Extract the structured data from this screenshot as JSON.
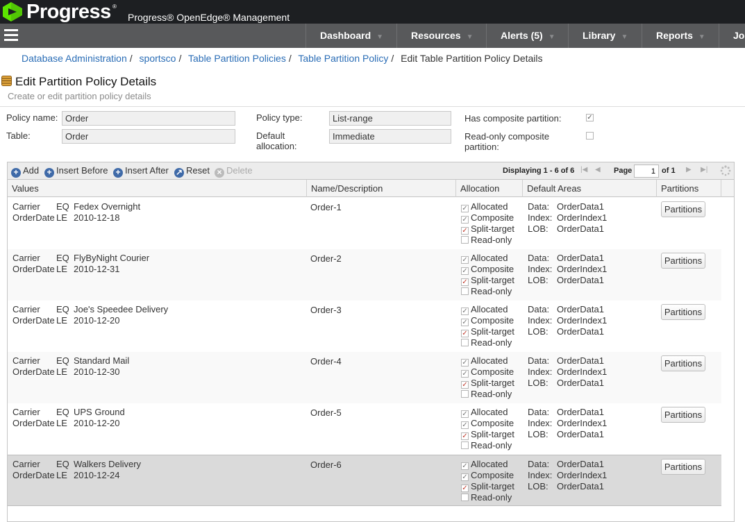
{
  "header": {
    "logo_text": "Progress",
    "logo_reg": "®",
    "product": "Progress® OpenEdge® Management"
  },
  "nav": {
    "items": [
      {
        "label": "Dashboard"
      },
      {
        "label": "Resources"
      },
      {
        "label": "Alerts (5)"
      },
      {
        "label": "Library"
      },
      {
        "label": "Reports"
      },
      {
        "label": "Jo"
      }
    ]
  },
  "breadcrumb": {
    "items": [
      "Database Administration",
      "sportsco",
      "Table Partition Policies",
      "Table Partition Policy"
    ],
    "current": "Edit Table Partition Policy Details",
    "sep": "/"
  },
  "page": {
    "title": "Edit Partition Policy Details",
    "subtitle": "Create or edit partition policy details"
  },
  "form": {
    "policy_name_label": "Policy name:",
    "policy_name_value": "Order",
    "table_label": "Table:",
    "table_value": "Order",
    "policy_type_label": "Policy type:",
    "policy_type_value": "List-range",
    "default_alloc_label_1": "Default",
    "default_alloc_label_2": "allocation:",
    "default_alloc_value": "Immediate",
    "composite_label": "Has composite partition:",
    "composite_checked": true,
    "readonly_label_1": "Read-only composite",
    "readonly_label_2": "partition:",
    "readonly_checked": false
  },
  "toolbar": {
    "add": "Add",
    "insert_before": "Insert Before",
    "insert_after": "Insert After",
    "reset": "Reset",
    "delete": "Delete",
    "displaying": "Displaying 1 - 6 of 6",
    "page_label": "Page",
    "page_value": "1",
    "of_label": "of 1"
  },
  "grid": {
    "columns": [
      "Values",
      "Name/Description",
      "Allocation",
      "Default Areas",
      "Partitions"
    ],
    "alloc_labels": [
      "Allocated",
      "Composite",
      "Split-target",
      "Read-only"
    ],
    "area_labels": [
      "Data:",
      "Index:",
      "LOB:"
    ],
    "partitions_button": "Partitions",
    "rows": [
      {
        "c1": "Carrier",
        "o1": "EQ",
        "v1": "Fedex Overnight",
        "c2": "OrderDate",
        "o2": "LE",
        "v2": "2010-12-18",
        "name": "Order-1",
        "data": "OrderData1",
        "index": "OrderIndex1",
        "lob": "OrderData1"
      },
      {
        "c1": "Carrier",
        "o1": "EQ",
        "v1": "FlyByNight Courier",
        "c2": "OrderDate",
        "o2": "LE",
        "v2": "2010-12-31",
        "name": "Order-2",
        "data": "OrderData1",
        "index": "OrderIndex1",
        "lob": "OrderData1"
      },
      {
        "c1": "Carrier",
        "o1": "EQ",
        "v1": "Joe's Speedee Delivery",
        "c2": "OrderDate",
        "o2": "LE",
        "v2": "2010-12-20",
        "name": "Order-3",
        "data": "OrderData1",
        "index": "OrderIndex1",
        "lob": "OrderData1"
      },
      {
        "c1": "Carrier",
        "o1": "EQ",
        "v1": "Standard Mail",
        "c2": "OrderDate",
        "o2": "LE",
        "v2": "2010-12-30",
        "name": "Order-4",
        "data": "OrderData1",
        "index": "OrderIndex1",
        "lob": "OrderData1"
      },
      {
        "c1": "Carrier",
        "o1": "EQ",
        "v1": "UPS Ground",
        "c2": "OrderDate",
        "o2": "LE",
        "v2": "2010-12-20",
        "name": "Order-5",
        "data": "OrderData1",
        "index": "OrderIndex1",
        "lob": "OrderData1"
      },
      {
        "c1": "Carrier",
        "o1": "EQ",
        "v1": "Walkers Delivery",
        "c2": "OrderDate",
        "o2": "LE",
        "v2": "2010-12-24",
        "name": "Order-6",
        "data": "OrderData1",
        "index": "OrderIndex1",
        "lob": "OrderData1"
      }
    ]
  },
  "colors": {
    "topbar": "#1d1f22",
    "navbar": "#58595b",
    "brand_green": "#5ce500",
    "link": "#2a6db6"
  }
}
